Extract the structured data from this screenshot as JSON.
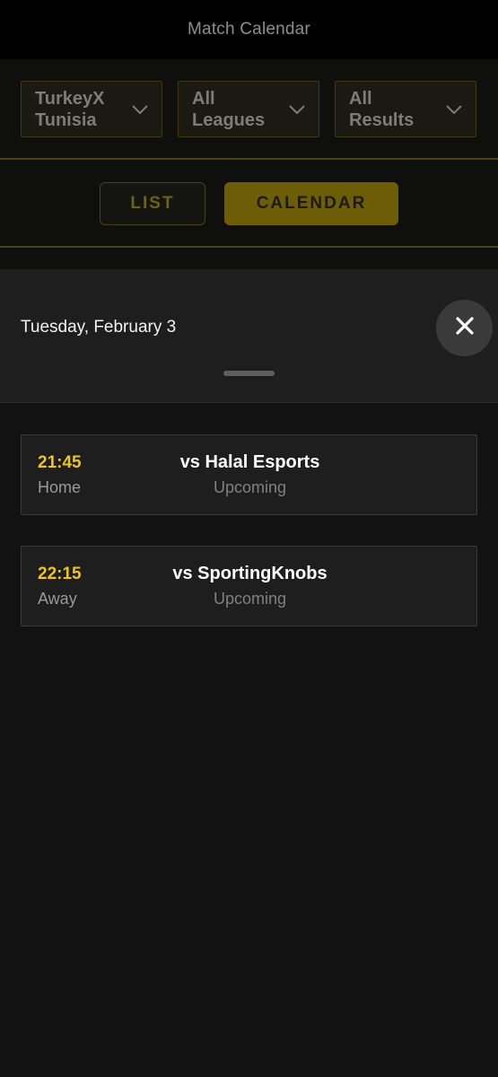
{
  "header": {
    "title": "Match Calendar"
  },
  "filters": {
    "team": "TurkeyX\nTunisia",
    "league": "All\nLeagues",
    "results": "All\nResults"
  },
  "view_toggle": {
    "list_label": "LIST",
    "calendar_label": "CALENDAR",
    "active": "calendar"
  },
  "sheet": {
    "date": "Tuesday, February 3",
    "matches": [
      {
        "time": "21:45",
        "side": "Home",
        "opponent": "vs Halal Esports",
        "status": "Upcoming"
      },
      {
        "time": "22:15",
        "side": "Away",
        "opponent": "vs SportingKnobs",
        "status": "Upcoming"
      }
    ]
  },
  "colors": {
    "accent": "#f0c419",
    "calendar_button_bg": "#6e5d07",
    "background": "#121212",
    "sheet_bg": "#1e1e1e"
  },
  "icons": {
    "dropdown": "chevron-down-icon",
    "close": "close-icon"
  }
}
